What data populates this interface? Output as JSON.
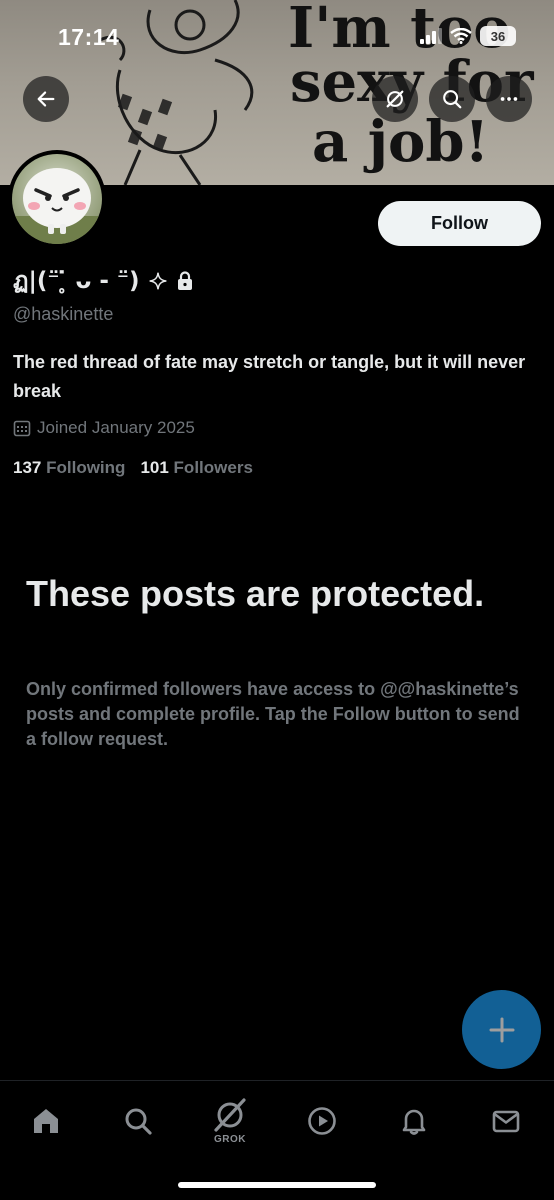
{
  "status_bar": {
    "time": "17:14",
    "battery": "36"
  },
  "banner": {
    "line1": "I'm too",
    "line2": "sexy for",
    "line3": "a job!"
  },
  "profile": {
    "display_name": "ฏ|(⁻̈ ̥̇ ᴗ - ⁻̈)",
    "handle": "@haskinette",
    "bio": "The red thread of fate may stretch or tangle, but it will never break",
    "joined": "Joined January 2025",
    "following_count": "137",
    "following_label": "Following",
    "followers_count": "101",
    "followers_label": "Followers"
  },
  "actions": {
    "follow_label": "Follow"
  },
  "protected": {
    "title": "These posts are protected.",
    "description": "Only confirmed followers have access to @@haskinette’s posts and complete profile. Tap the Follow button to send a follow request."
  },
  "tabbar": {
    "grok_label": "GROK"
  },
  "colors": {
    "accent": "#1d9bf0",
    "text_secondary": "#71767b",
    "background": "#000000"
  }
}
